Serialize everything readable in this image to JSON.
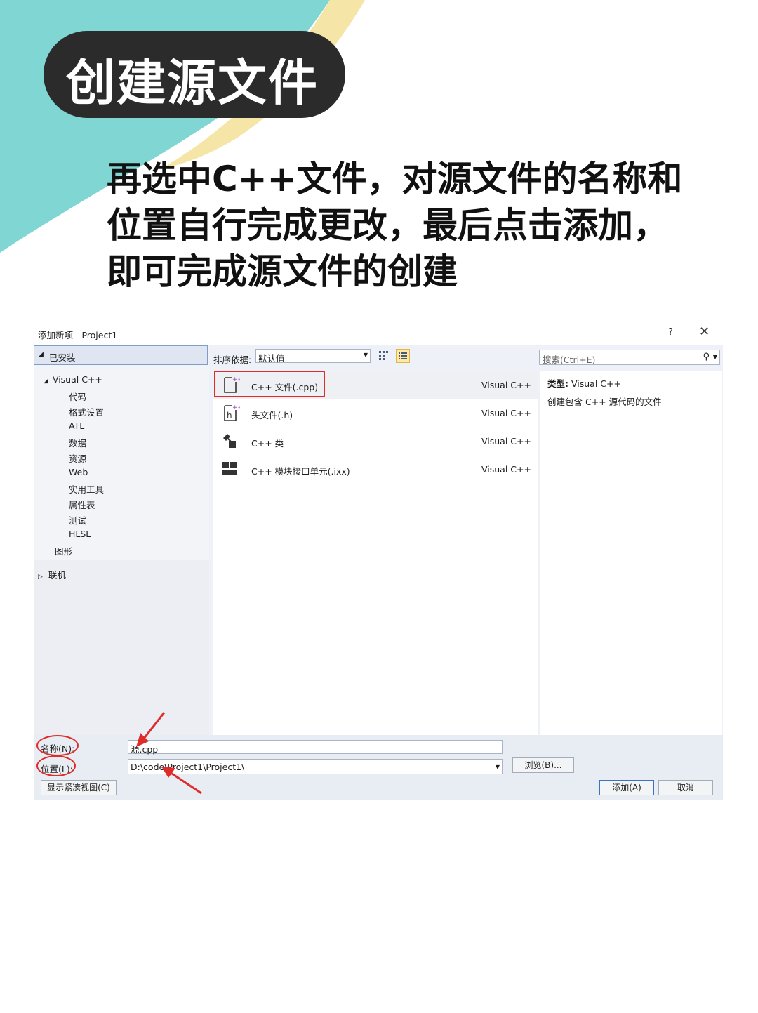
{
  "header": {
    "title": "创建源文件",
    "instruction_lines": [
      "再选中C++文件，对源文件的名称和",
      "位置自行完成更改，最后点击添加，",
      "即可完成源文件的创建"
    ]
  },
  "colors": {
    "teal_decor": "#7fd6d2",
    "yellow_decor": "#f5e6a8",
    "title_pill": "#2b2b2b",
    "highlight_red": "#e02b2b"
  },
  "dialog": {
    "title": "添加新项 - Project1",
    "help": "?",
    "close": "✕",
    "left": {
      "installed": "已安装",
      "root": "Visual C++",
      "items": [
        "代码",
        "格式设置",
        "ATL",
        "数据",
        "资源",
        "Web",
        "实用工具",
        "属性表",
        "测试",
        "HLSL"
      ],
      "graphics": "图形",
      "online": "联机"
    },
    "sort": {
      "label": "排序依据:",
      "value": "默认值"
    },
    "search": {
      "placeholder": "搜索(Ctrl+E)"
    },
    "templates": [
      {
        "name": "C++ 文件(.cpp)",
        "lang": "Visual C++",
        "icon": "cpp-file-icon"
      },
      {
        "name": "头文件(.h)",
        "lang": "Visual C++",
        "icon": "header-file-icon"
      },
      {
        "name": "C++ 类",
        "lang": "Visual C++",
        "icon": "cpp-class-icon"
      },
      {
        "name": "C++ 模块接口单元(.ixx)",
        "lang": "Visual C++",
        "icon": "module-icon"
      }
    ],
    "info": {
      "type_label": "类型:",
      "type_value": "Visual C++",
      "description": "创建包含 C++ 源代码的文件"
    },
    "bottom": {
      "name_label": "名称(N):",
      "name_value": "源.cpp",
      "location_label": "位置(L):",
      "location_value": "D:\\code\\Project1\\Project1\\",
      "browse": "浏览(B)...",
      "compact_view": "显示紧凑视图(C)",
      "add": "添加(A)",
      "cancel": "取消"
    }
  }
}
